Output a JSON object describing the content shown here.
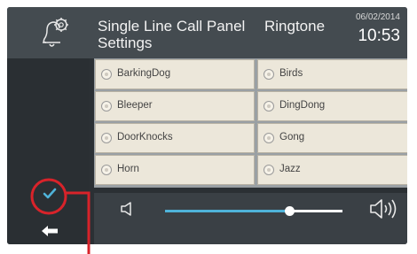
{
  "header": {
    "title_line1": "Single Line Call Panel",
    "title_line2": "Settings",
    "title_ringtone": "Ringtone",
    "date": "06/02/2014",
    "time": "10:53"
  },
  "ringtones": [
    {
      "label": "BarkingDog"
    },
    {
      "label": "Birds"
    },
    {
      "label": "Bleeper"
    },
    {
      "label": "DingDong"
    },
    {
      "label": "DoorKnocks"
    },
    {
      "label": "Gong"
    },
    {
      "label": "Horn"
    },
    {
      "label": "Jazz"
    }
  ],
  "volume": {
    "level": 0.7
  },
  "colors": {
    "accent": "#4fb3d9",
    "annotation": "#d8232a",
    "cell_bg": "#ece7da"
  },
  "icons": {
    "settings": "bell-gear-icon",
    "confirm": "check-icon",
    "back": "arrow-left-icon"
  }
}
